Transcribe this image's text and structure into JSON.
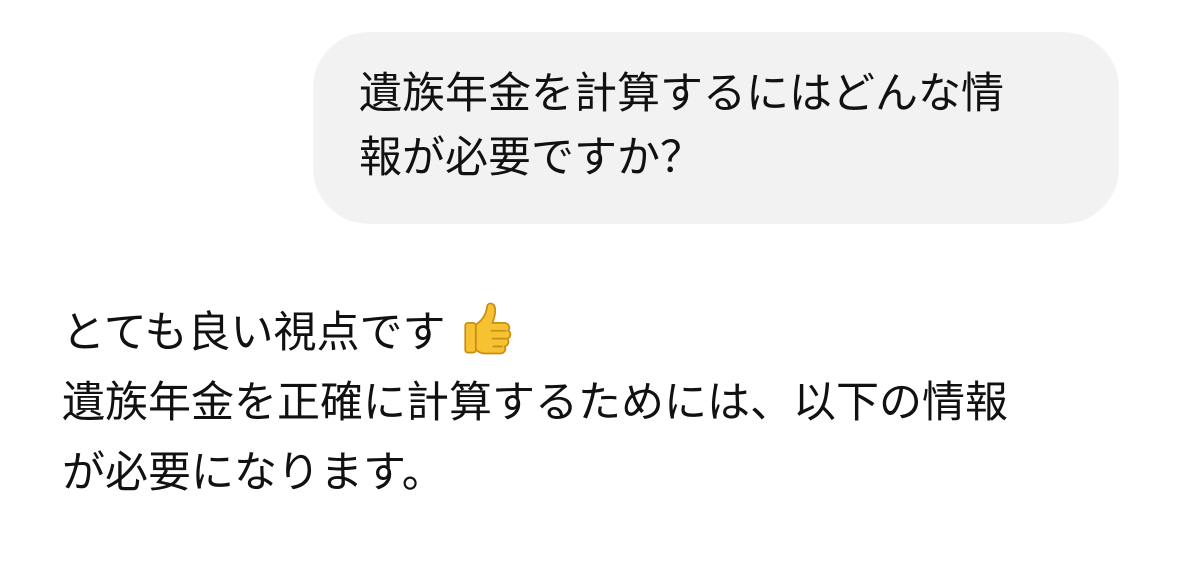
{
  "user_message": {
    "lines": [
      "遺族年金を計算するにはどんな情",
      "報が必要ですか？"
    ]
  },
  "assistant_message": {
    "first_line": "とても良い視点です",
    "emoji_icon": "thumbs-up-icon",
    "lines": [
      "遺族年金を正確に計算するためには、以下の情報",
      "が必要になります。"
    ]
  }
}
